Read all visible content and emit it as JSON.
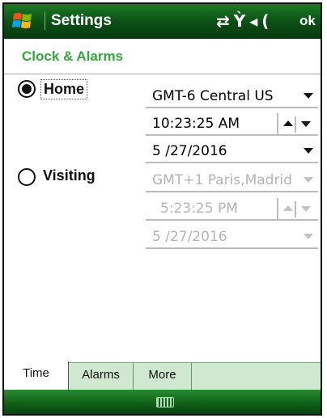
{
  "titlebar": {
    "title": "Settings",
    "status_icons": "⇄ Y◂",
    "ok_label": "ok"
  },
  "page": {
    "title": "Clock & Alarms"
  },
  "home": {
    "label": "Home",
    "selected": true,
    "timezone": "GMT-6 Central US",
    "time": "10:23:25 AM",
    "date": "5 /27/2016"
  },
  "visiting": {
    "label": "Visiting",
    "selected": false,
    "timezone": "GMT+1 Paris,Madrid",
    "time": "5:23:25 PM",
    "date": "5 /27/2016"
  },
  "tabs": [
    {
      "label": "Time",
      "active": true
    },
    {
      "label": "Alarms",
      "active": false
    },
    {
      "label": "More",
      "active": false
    }
  ],
  "colors": {
    "accent": "#34a83a",
    "titlebar": "#0b4d14",
    "disabled_text": "#b4b4b4"
  }
}
